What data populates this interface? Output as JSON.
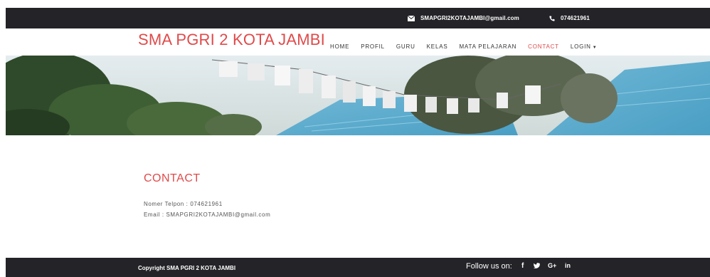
{
  "topbar": {
    "email": "SMAPGRI2KOTAJAMBI@gmail.com",
    "email_icon": "envelope-icon",
    "phone": "074621961",
    "phone_icon": "phone-icon"
  },
  "brand": "SMA PGRI 2 KOTA JAMBI",
  "nav": {
    "items": [
      "HOME",
      "PROFIL",
      "GURU",
      "KELAS",
      "MATA PELAJARAN",
      "CONTACT",
      "LOGIN"
    ],
    "active": "CONTACT"
  },
  "content": {
    "title": "CONTACT",
    "phone_line": "Nomer Telpon : 074621961",
    "email_line": "Email : SMAPGRI2KOTAJAMBI@gmail.com"
  },
  "footer": {
    "copyright": "Copyright SMA PGRI 2 KOTA JAMBI",
    "follow_label": "Follow us on:",
    "social": [
      {
        "icon": "facebook-icon",
        "glyph": "f"
      },
      {
        "icon": "twitter-icon",
        "glyph": "🐦"
      },
      {
        "icon": "google-plus-icon",
        "glyph": "G+"
      },
      {
        "icon": "linkedin-icon",
        "glyph": "in"
      }
    ]
  },
  "colors": {
    "accent": "#e04a4a",
    "dark_bar": "#232328",
    "body_text": "#555555"
  }
}
